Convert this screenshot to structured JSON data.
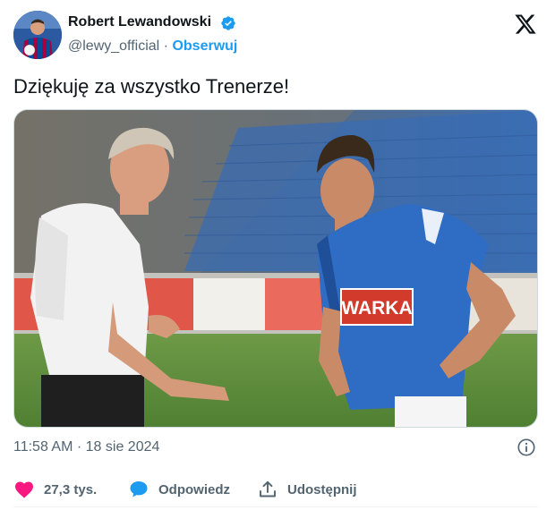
{
  "author": {
    "name": "Robert Lewandowski",
    "handle": "@lewy_official",
    "separator": "·",
    "follow_label": "Obserwuj"
  },
  "tweet": {
    "text": "Dziękuję za wszystko Trenerze!"
  },
  "meta": {
    "time": "11:58 AM",
    "separator": "·",
    "date": "18 sie 2024"
  },
  "actions": {
    "likes": "27,3 tys.",
    "reply_label": "Odpowiedz",
    "share_label": "Udostępnij"
  },
  "media": {
    "shirt_sponsor": "WARKA"
  },
  "colors": {
    "accent": "#1d9bf0",
    "like": "#f91880",
    "muted": "#536471",
    "text": "#0f1419"
  },
  "icons": {
    "verified": "verified-badge-icon",
    "brand": "x-logo-icon",
    "info": "info-icon",
    "like": "heart-icon",
    "reply": "speech-bubble-icon",
    "share": "share-upload-icon"
  }
}
